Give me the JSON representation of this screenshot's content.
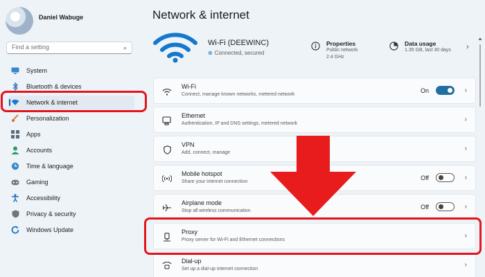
{
  "user": {
    "name": "Daniel Wabuge"
  },
  "search": {
    "placeholder": "Find a setting"
  },
  "sidebar": {
    "items": [
      {
        "label": "System",
        "icon": "monitor-icon"
      },
      {
        "label": "Bluetooth & devices",
        "icon": "bluetooth-icon"
      },
      {
        "label": "Network & internet",
        "icon": "wifi-icon",
        "selected": true
      },
      {
        "label": "Personalization",
        "icon": "brush-icon"
      },
      {
        "label": "Apps",
        "icon": "apps-icon"
      },
      {
        "label": "Accounts",
        "icon": "person-icon"
      },
      {
        "label": "Time & language",
        "icon": "globe-clock-icon"
      },
      {
        "label": "Gaming",
        "icon": "gamepad-icon"
      },
      {
        "label": "Accessibility",
        "icon": "accessibility-icon"
      },
      {
        "label": "Privacy & security",
        "icon": "shield-icon"
      },
      {
        "label": "Windows Update",
        "icon": "update-icon"
      }
    ]
  },
  "page": {
    "title": "Network & internet"
  },
  "header": {
    "wifi_name": "Wi-Fi (DEEWINC)",
    "wifi_status": "Connected, secured",
    "properties": {
      "title": "Properties",
      "line1": "Public network",
      "line2": "2.4 GHz"
    },
    "data_usage": {
      "title": "Data usage",
      "line1": "1.35 GB, last 30 days"
    }
  },
  "cards": [
    {
      "title": "Wi-Fi",
      "subtitle": "Connect, manage known networks, metered network",
      "icon": "wifi-icon",
      "toggle": "On",
      "toggle_on": true
    },
    {
      "title": "Ethernet",
      "subtitle": "Authentication, IP and DNS settings, metered network",
      "icon": "ethernet-icon"
    },
    {
      "title": "VPN",
      "subtitle": "Add, connect, manage",
      "icon": "shield-icon"
    },
    {
      "title": "Mobile hotspot",
      "subtitle": "Share your internet connection",
      "icon": "hotspot-icon",
      "toggle": "Off",
      "toggle_on": false
    },
    {
      "title": "Airplane mode",
      "subtitle": "Stop all wireless communication",
      "icon": "airplane-icon",
      "toggle": "Off",
      "toggle_on": false
    },
    {
      "title": "Proxy",
      "subtitle": "Proxy server for Wi-Fi and Ethernet connections",
      "icon": "proxy-icon"
    },
    {
      "title": "Dial-up",
      "subtitle": "Set up a dial-up internet connection",
      "icon": "dialup-icon"
    }
  ],
  "colors": {
    "accent": "#0067c0",
    "highlight": "#e3141b",
    "toggle_on": "#1f6fa0"
  }
}
